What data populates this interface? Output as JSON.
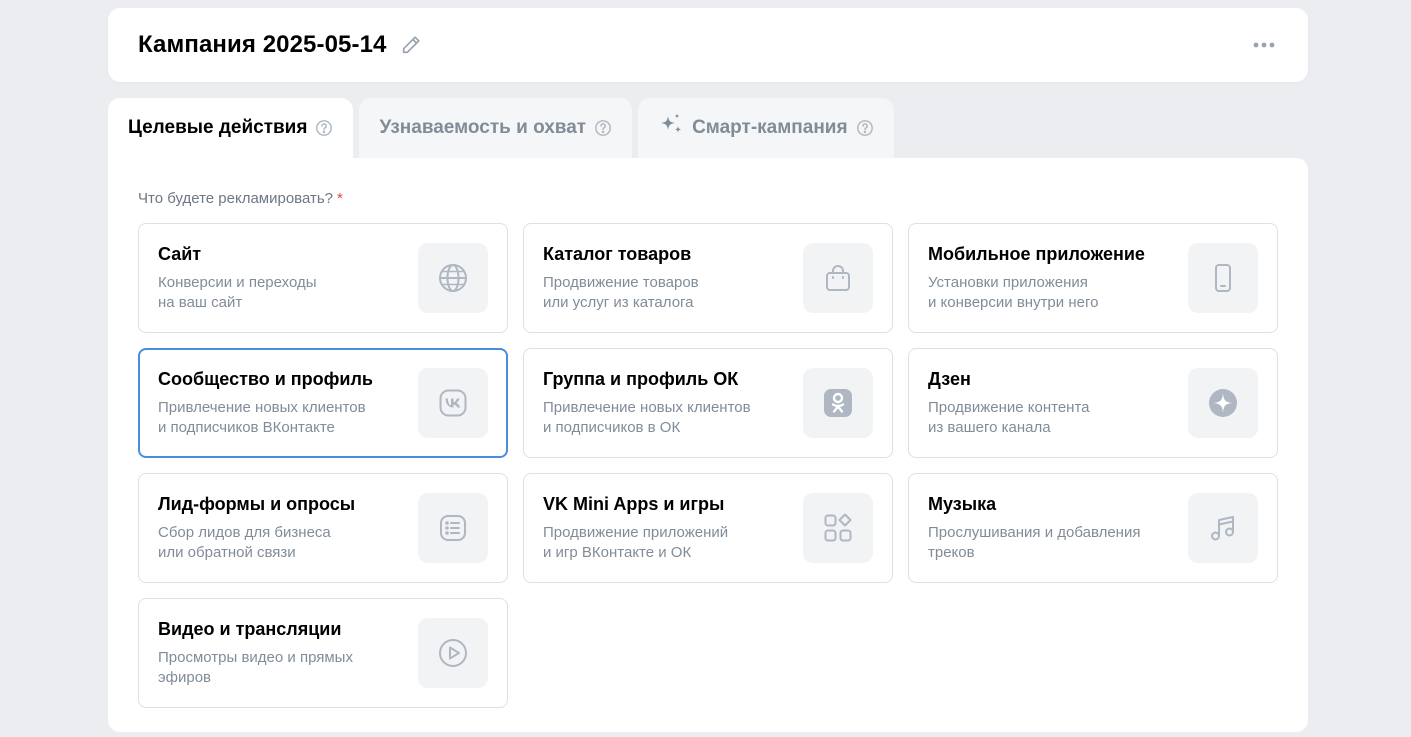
{
  "header": {
    "title": "Кампания 2025-05-14",
    "edit_icon": "pencil-icon",
    "more_icon": "more-horizontal-icon"
  },
  "tabs": [
    {
      "label": "Целевые действия",
      "active": true,
      "icon": "help-circle-icon"
    },
    {
      "label": "Узнаваемость и охват",
      "active": false,
      "icon": "help-circle-icon"
    },
    {
      "label": "Смарт-кампания",
      "active": false,
      "icon": "help-circle-icon",
      "lead_icon": "sparkle-icon"
    }
  ],
  "form": {
    "question": "Что будете рекламировать?",
    "required_mark": "*"
  },
  "options": [
    {
      "title": "Сайт",
      "desc1": "Конверсии и переходы",
      "desc2": "на ваш сайт",
      "icon": "globe-icon",
      "selected": false
    },
    {
      "title": "Каталог товаров",
      "desc1": "Продвижение товаров",
      "desc2": "или услуг из каталога",
      "icon": "shopping-bag-icon",
      "selected": false
    },
    {
      "title": "Мобильное приложение",
      "desc1": "Установки приложения",
      "desc2": "и конверсии внутри него",
      "icon": "smartphone-icon",
      "selected": false
    },
    {
      "title": "Сообщество и профиль",
      "desc1": "Привлечение новых клиентов",
      "desc2": "и подписчиков ВКонтакте",
      "icon": "vk-logo-icon",
      "selected": true
    },
    {
      "title": "Группа и профиль ОК",
      "desc1": "Привлечение новых клиентов",
      "desc2": "и подписчиков в ОК",
      "icon": "ok-logo-icon",
      "selected": false
    },
    {
      "title": "Дзен",
      "desc1": "Продвижение контента",
      "desc2": "из вашего канала",
      "icon": "dzen-logo-icon",
      "selected": false
    },
    {
      "title": "Лид-формы и опросы",
      "desc1": "Сбор лидов для бизнеса",
      "desc2": "или обратной связи",
      "icon": "list-form-icon",
      "selected": false
    },
    {
      "title": "VK Mini Apps и игры",
      "desc1": "Продвижение приложений",
      "desc2": "и игр ВКонтакте и ОК",
      "icon": "apps-grid-icon",
      "selected": false
    },
    {
      "title": "Музыка",
      "desc1": "Прослушивания и добавления",
      "desc2": "треков",
      "icon": "music-note-icon",
      "selected": false
    },
    {
      "title": "Видео и трансляции",
      "desc1": "Просмотры видео и прямых",
      "desc2": "эфиров",
      "icon": "play-circle-icon",
      "selected": false
    }
  ],
  "colors": {
    "page_bg": "#ebedf0",
    "card_border": "#dce1e6",
    "selected_border": "#4a8cde",
    "secondary_text": "#818c99",
    "icon_color": "#aeb7c2",
    "required": "#e64646"
  }
}
